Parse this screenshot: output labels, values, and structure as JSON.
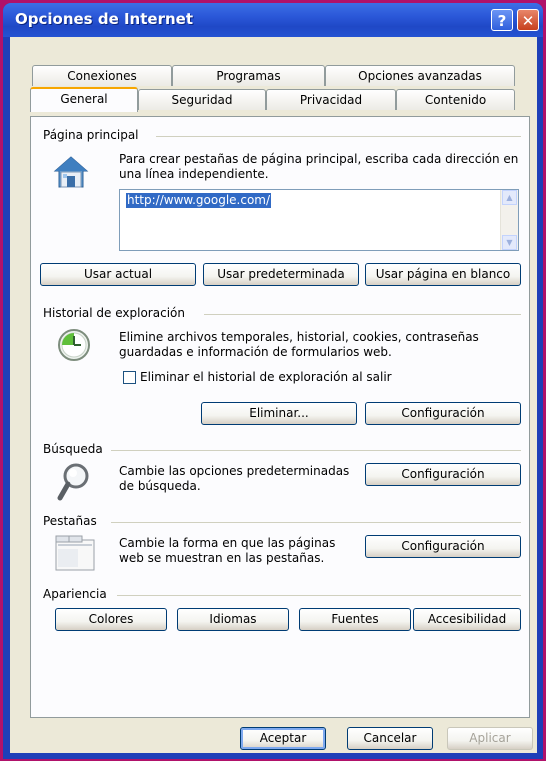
{
  "window": {
    "title": "Opciones de Internet",
    "help_label": "?",
    "close_label": "✕"
  },
  "tabs": {
    "row1": [
      "Conexiones",
      "Programas",
      "Opciones avanzadas"
    ],
    "row2": [
      "General",
      "Seguridad",
      "Privacidad",
      "Contenido"
    ],
    "active": "General"
  },
  "home": {
    "heading": "Página principal",
    "description": "Para crear pestañas de página principal, escriba cada dirección en una línea independiente.",
    "url": "http://www.google.com/",
    "btn_current": "Usar actual",
    "btn_default": "Usar predeterminada",
    "btn_blank": "Usar página en blanco"
  },
  "history": {
    "heading": "Historial de exploración",
    "description": "Elimine archivos temporales, historial, cookies, contraseñas guardadas e información de formularios web.",
    "checkbox_label": "Eliminar el historial de exploración al salir",
    "checkbox_checked": false,
    "btn_delete": "Eliminar...",
    "btn_settings": "Configuración"
  },
  "search": {
    "heading": "Búsqueda",
    "description": "Cambie las opciones predeterminadas de búsqueda.",
    "btn_settings": "Configuración"
  },
  "tabs_section": {
    "heading": "Pestañas",
    "description": "Cambie la forma en que las páginas web se muestran en las pestañas.",
    "btn_settings": "Configuración"
  },
  "appearance": {
    "heading": "Apariencia",
    "btn_colors": "Colores",
    "btn_languages": "Idiomas",
    "btn_fonts": "Fuentes",
    "btn_accessibility": "Accesibilidad"
  },
  "footer": {
    "ok": "Aceptar",
    "cancel": "Cancelar",
    "apply": "Aplicar"
  },
  "colors": {
    "border": "#b0126a",
    "titlebar": "#2a57d8",
    "face": "#ece9d8",
    "selection": "#316ac5"
  }
}
